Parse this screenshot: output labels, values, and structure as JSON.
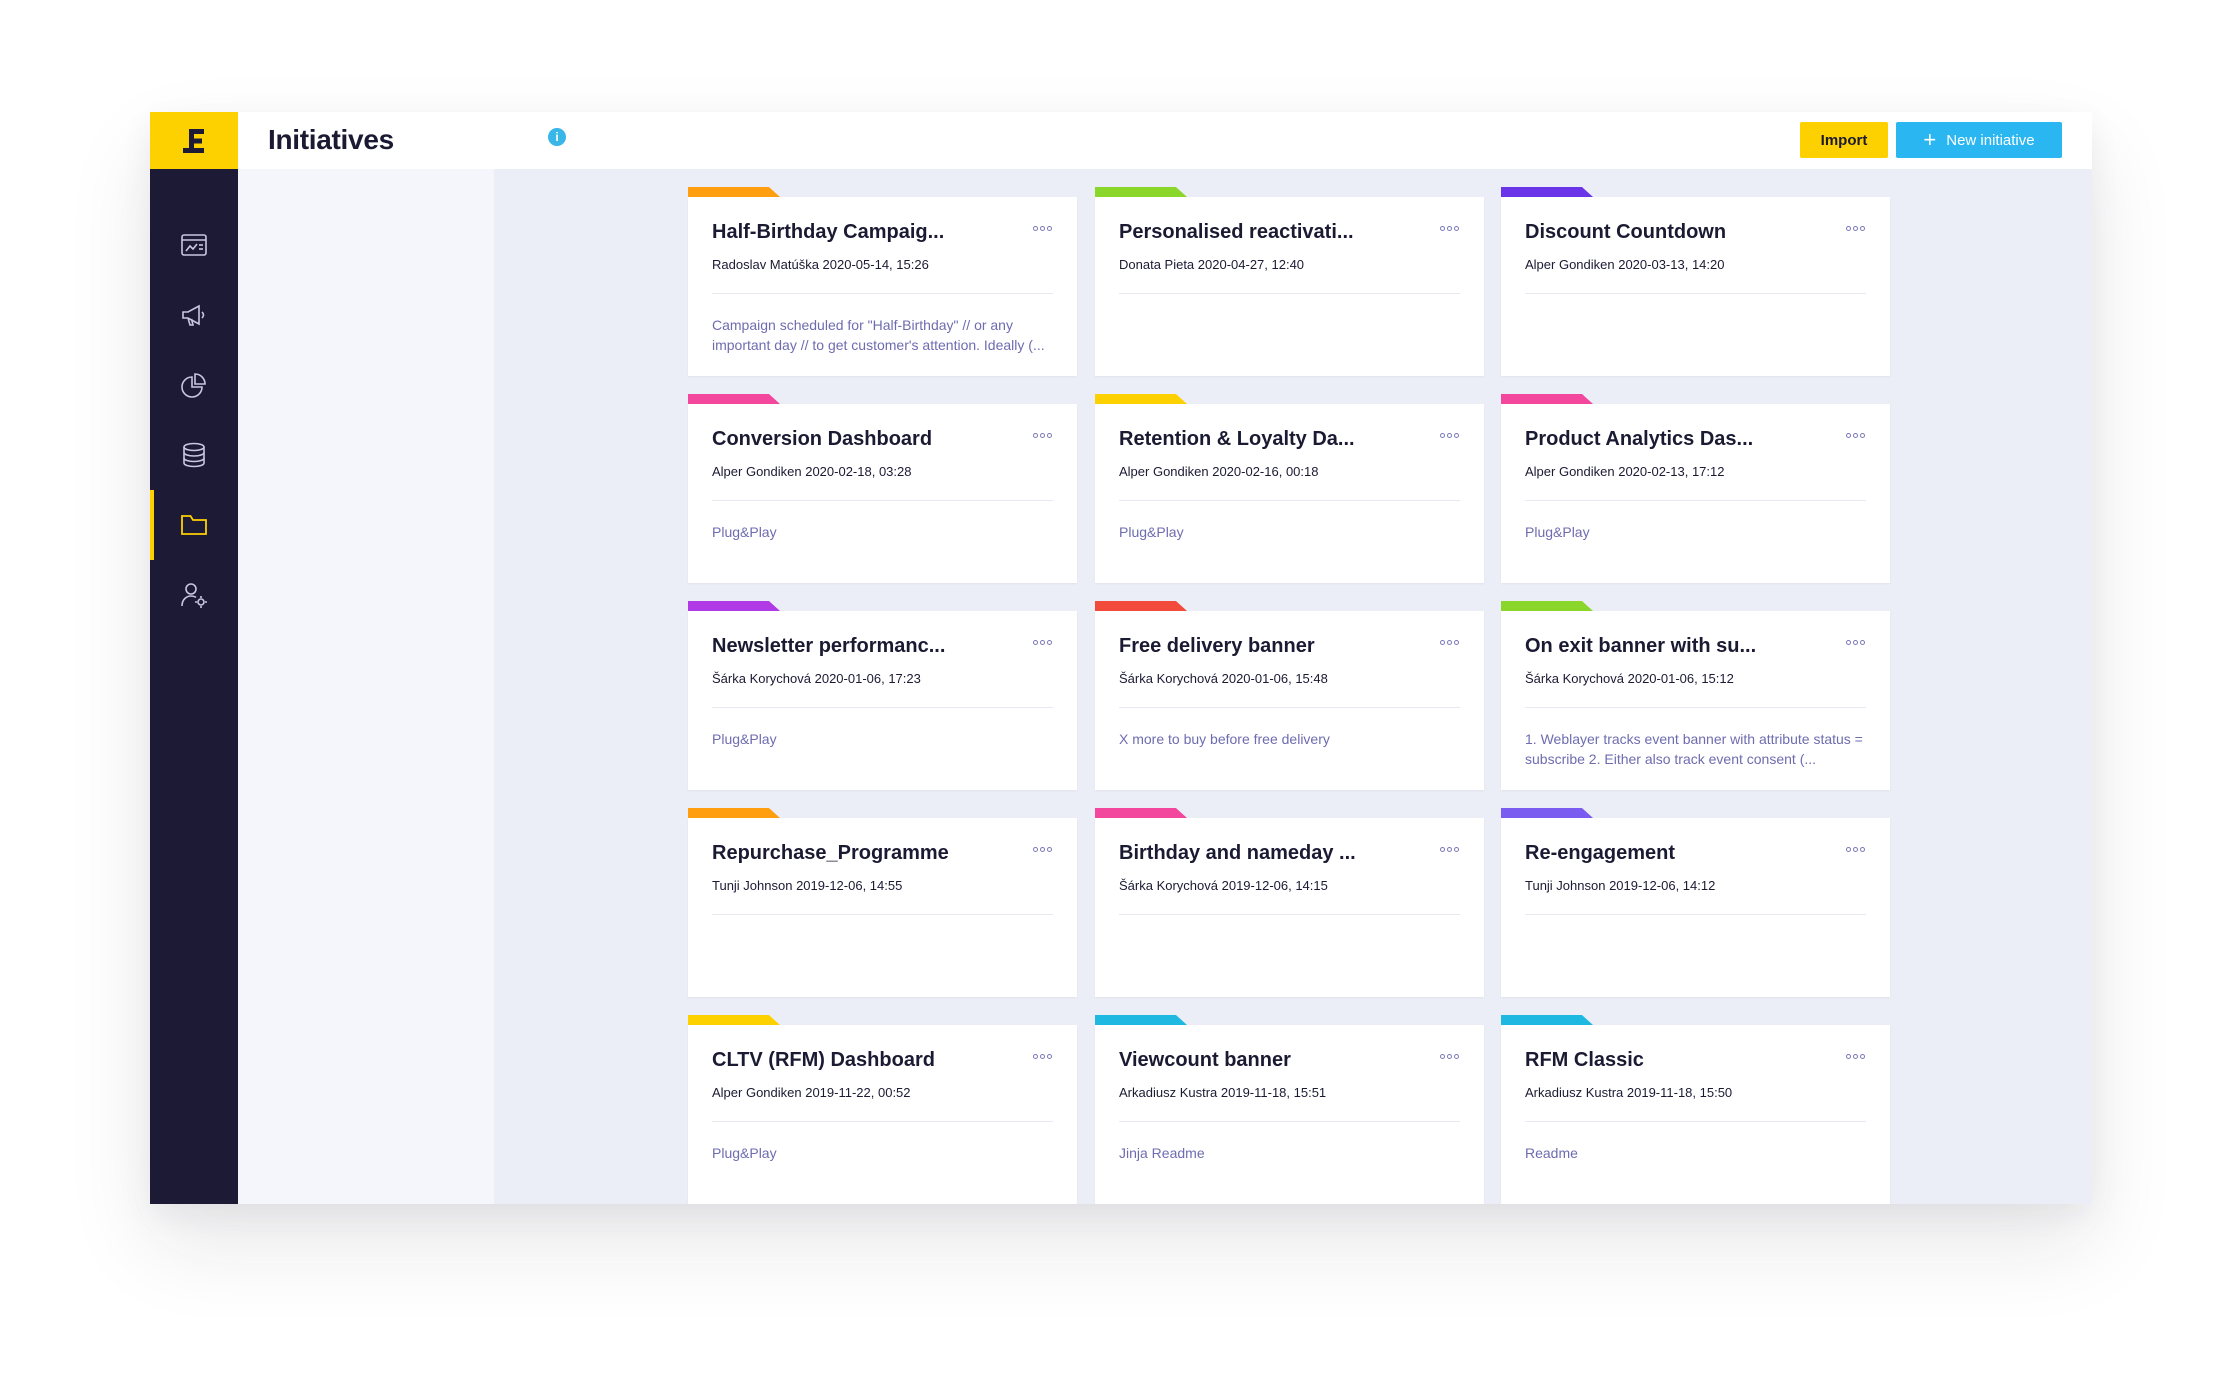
{
  "header": {
    "title": "Initiatives",
    "info_glyph": "i",
    "import_label": "Import",
    "new_label": "New initiative",
    "new_plus": "+"
  },
  "colors": {
    "brand_yellow": "#fdd000",
    "sidebar_bg": "#1c1a34",
    "primary_blue": "#29b6f1",
    "link_purple": "#6e6cb0"
  },
  "sidebar": {
    "logo_icon": "exponea-logo-icon",
    "items": [
      {
        "icon": "dashboard-icon",
        "active": false
      },
      {
        "icon": "megaphone-icon",
        "active": false
      },
      {
        "icon": "pie-chart-icon",
        "active": false
      },
      {
        "icon": "database-icon",
        "active": false
      },
      {
        "icon": "folder-icon",
        "active": true
      },
      {
        "icon": "user-settings-icon",
        "active": false
      }
    ]
  },
  "cards": [
    {
      "title": "Half-Birthday Campaig...",
      "meta": "Radoslav Matúška 2020-05-14, 15:26",
      "desc": "Campaign scheduled for \"Half-Birthday\" // or any important day // to get customer's attention. Ideally (...",
      "color": "#ff9e0f"
    },
    {
      "title": "Personalised reactivati...",
      "meta": "Donata Pieta 2020-04-27, 12:40",
      "desc": "",
      "color": "#8bd62a"
    },
    {
      "title": "Discount Countdown",
      "meta": "Alper Gondiken 2020-03-13, 14:20",
      "desc": "",
      "color": "#6a35e8"
    },
    {
      "title": "Conversion Dashboard",
      "meta": "Alper Gondiken 2020-02-18, 03:28",
      "desc": "Plug&Play",
      "color": "#f2479c"
    },
    {
      "title": "Retention & Loyalty Da...",
      "meta": "Alper Gondiken 2020-02-16, 00:18",
      "desc": "Plug&Play",
      "color": "#fdd000"
    },
    {
      "title": "Product Analytics Das...",
      "meta": "Alper Gondiken 2020-02-13, 17:12",
      "desc": "Plug&Play",
      "color": "#f2479c"
    },
    {
      "title": "Newsletter performanc...",
      "meta": "Šárka Korychová 2020-01-06, 17:23",
      "desc": "Plug&Play",
      "color": "#b03be6"
    },
    {
      "title": "Free delivery banner",
      "meta": "Šárka Korychová 2020-01-06, 15:48",
      "desc": "X more to buy before free delivery",
      "color": "#f24a3b"
    },
    {
      "title": "On exit banner with su...",
      "meta": "Šárka Korychová 2020-01-06, 15:12",
      "desc": "1. Weblayer tracks event banner with attribute status = subscribe 2. Either also track event consent (...",
      "color": "#8bd62a"
    },
    {
      "title": "Repurchase_Programme",
      "meta": "Tunji Johnson 2019-12-06, 14:55",
      "desc": "",
      "color": "#ff9e0f"
    },
    {
      "title": "Birthday and nameday ...",
      "meta": "Šárka Korychová 2019-12-06, 14:15",
      "desc": "",
      "color": "#f2479c"
    },
    {
      "title": "Re-engagement",
      "meta": "Tunji Johnson 2019-12-06, 14:12",
      "desc": "",
      "color": "#7b5cf0"
    },
    {
      "title": "CLTV (RFM) Dashboard",
      "meta": "Alper Gondiken 2019-11-22, 00:52",
      "desc": "Plug&Play",
      "color": "#fdd000"
    },
    {
      "title": "Viewcount banner",
      "meta": "Arkadiusz Kustra 2019-11-18, 15:51",
      "desc": "Jinja Readme",
      "color": "#1fb8e0"
    },
    {
      "title": "RFM Classic",
      "meta": "Arkadiusz Kustra 2019-11-18, 15:50",
      "desc": "Readme",
      "color": "#1fb8e0"
    }
  ]
}
